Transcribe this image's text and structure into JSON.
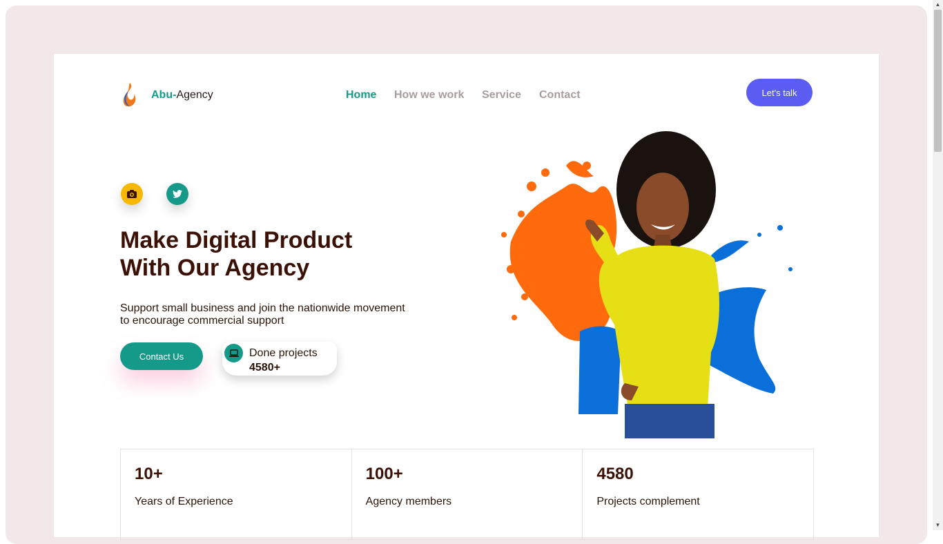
{
  "brand": {
    "part1": "Abu-",
    "part2": "Agency"
  },
  "nav": {
    "home": "Home",
    "how": "How we work",
    "service": "Service",
    "contact": "Contact"
  },
  "cta_talk": "Let's talk",
  "social": {
    "icons": [
      "camera-icon",
      "twitter-icon"
    ]
  },
  "hero": {
    "title_line1": "Make Digital Product",
    "title_line2": "With Our Agency",
    "subtitle_line1": "Support small business and join the nationwide movement",
    "subtitle_line2": "to encourage commercial support",
    "contact_button": "Contact Us",
    "done_label": "Done projects",
    "done_value": "4580+"
  },
  "stats": [
    {
      "value": "10+",
      "label": "Years of Experience"
    },
    {
      "value": "100+",
      "label": "Agency members"
    },
    {
      "value": "4580",
      "label": "Projects complement"
    }
  ],
  "colors": {
    "primary": "#159a8a",
    "accent": "#5b5cf2",
    "yellow": "#f7b800",
    "heading": "#3b1106",
    "background": "#f3e8e9"
  }
}
